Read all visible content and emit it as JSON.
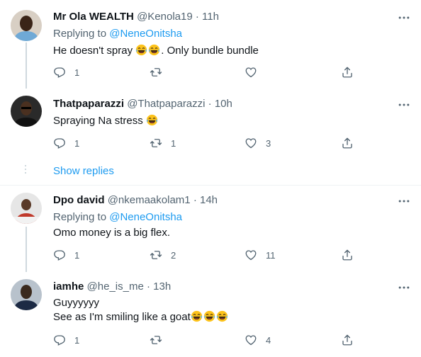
{
  "tweets": [
    {
      "name": "Mr Ola WEALTH",
      "handle": "@Kenola19",
      "sep": "·",
      "time": "11h",
      "replying_label": "Replying to",
      "replying_handle": "@NeneOnitsha",
      "text_before": "He doesn't spray ",
      "text_after": ". Only bundle bundle",
      "lines": [],
      "replies": "1",
      "retweets": "",
      "likes": ""
    },
    {
      "name": "Thatpaparazzi",
      "handle": "@Thatpaparazzi",
      "sep": "·",
      "time": "10h",
      "text_before": "Spraying Na stress ",
      "replies": "1",
      "retweets": "1",
      "likes": "3"
    },
    {
      "name": "Dpo david",
      "handle": "@nkemaakolam1",
      "sep": "·",
      "time": "14h",
      "replying_label": "Replying to",
      "replying_handle": "@NeneOnitsha",
      "text_before": "Omo money is a big flex.",
      "replies": "1",
      "retweets": "2",
      "likes": "11"
    },
    {
      "name": "iamhe",
      "handle": "@he_is_me",
      "sep": "·",
      "time": "13h",
      "line1": "Guyyyyyy",
      "line2": "See as I'm smiling like a goat",
      "replies": "1",
      "retweets": "",
      "likes": "4"
    }
  ],
  "show_replies_label": "Show replies",
  "colors": {
    "accent": "#1d9bf0",
    "muted": "#536471",
    "text": "#0f1419",
    "divider": "#eff3f4"
  },
  "icons": [
    "more-icon",
    "reply-icon",
    "retweet-icon",
    "like-icon",
    "share-icon",
    "face-with-tears-of-joy-emoji"
  ]
}
